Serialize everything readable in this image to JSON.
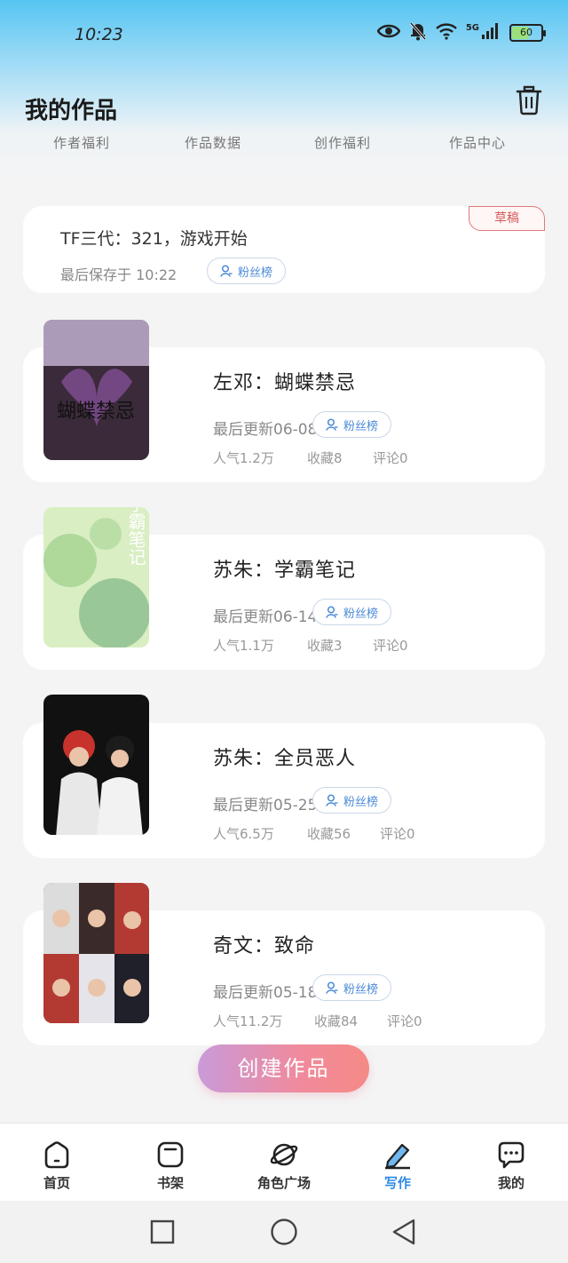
{
  "status_bar": {
    "time": "10:23",
    "network": "5G",
    "battery": "60",
    "battery_level": 0.6
  },
  "header": {
    "title": "我的作品"
  },
  "tabs": [
    {
      "label": "作者福利"
    },
    {
      "label": "作品数据"
    },
    {
      "label": "创作福利"
    },
    {
      "label": "作品中心"
    }
  ],
  "draft": {
    "title": "TF三代：321，游戏开始",
    "meta": "最后保存于 10:22",
    "badge": "草稿",
    "fan_button": "粉丝榜"
  },
  "books": [
    {
      "title": "左邓：蝴蝶禁忌",
      "update": "最后更新06-08",
      "fan_button": "粉丝榜",
      "popularity": "人气1.2万",
      "favorites": "收藏8",
      "comments": "评论0"
    },
    {
      "title": "苏朱：学霸笔记",
      "update": "最后更新06-14",
      "fan_button": "粉丝榜",
      "popularity": "人气1.1万",
      "favorites": "收藏3",
      "comments": "评论0"
    },
    {
      "title": "苏朱：全员恶人",
      "update": "最后更新05-25",
      "fan_button": "粉丝榜",
      "popularity": "人气6.5万",
      "favorites": "收藏56",
      "comments": "评论0"
    },
    {
      "title": "奇文：致命",
      "update": "最后更新05-18",
      "fan_button": "粉丝榜",
      "popularity": "人气11.2万",
      "favorites": "收藏84",
      "comments": "评论0"
    }
  ],
  "covers": [
    {
      "text": "蝴蝶禁忌",
      "colors": [
        "#3a2a3a",
        "#7a4a8a",
        "#c9b8d8"
      ]
    },
    {
      "text": "学霸笔记",
      "colors": [
        "#9ccf8a",
        "#d9eec2",
        "#6fae7a"
      ]
    },
    {
      "text": "",
      "colors": [
        "#111111",
        "#2a2a2a",
        "#c8322c"
      ]
    },
    {
      "text": "",
      "colors": [
        "#1a1f2a",
        "#3a2a2a",
        "#b33a33"
      ]
    }
  ],
  "create_button": "创建作品",
  "bottom_nav": [
    {
      "label": "首页",
      "icon": "home-icon",
      "active": false
    },
    {
      "label": "书架",
      "icon": "bookshelf-icon",
      "active": false
    },
    {
      "label": "角色广场",
      "icon": "planet-icon",
      "active": false
    },
    {
      "label": "写作",
      "icon": "pen-icon",
      "active": true
    },
    {
      "label": "我的",
      "icon": "chat-bubble-icon",
      "active": false
    }
  ],
  "colors": {
    "accent": "#2d8ae6",
    "draft_badge": "#d45a5a",
    "fan_button_text": "#4b8ad8"
  }
}
